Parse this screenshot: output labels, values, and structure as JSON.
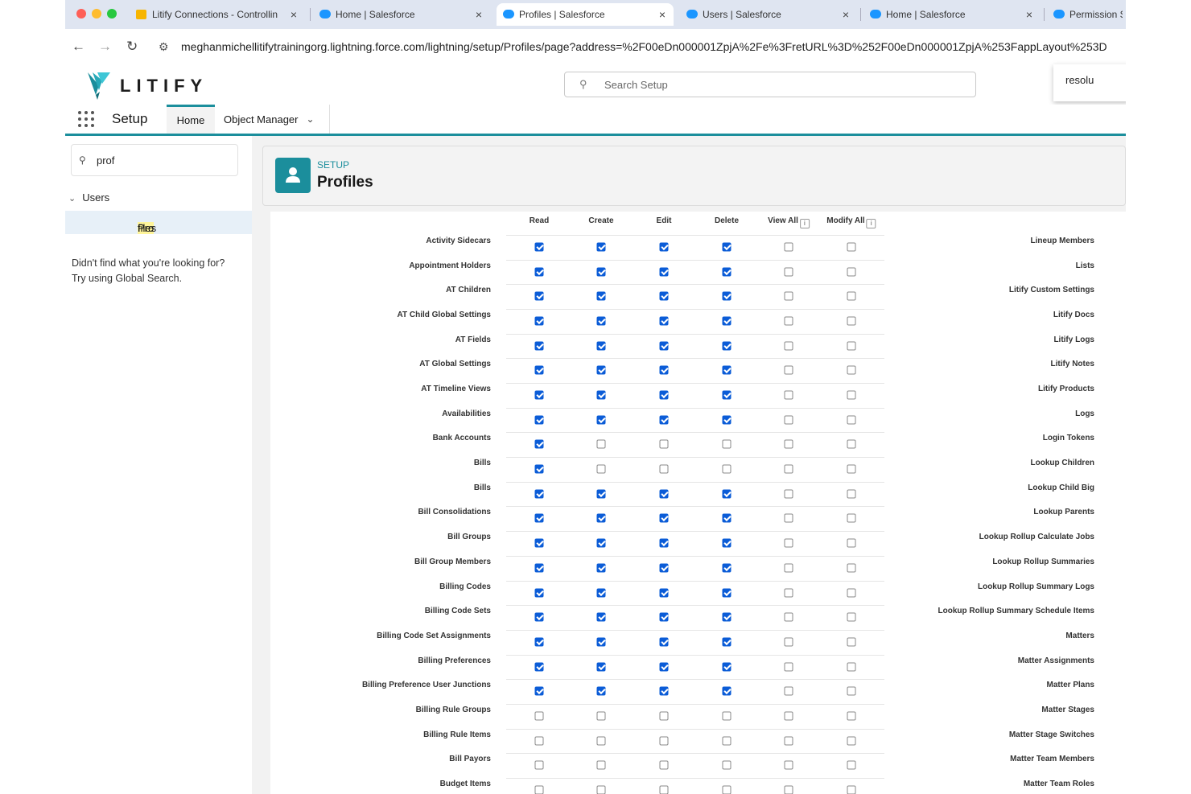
{
  "browser": {
    "tabs": [
      {
        "label": "Litify Connections - Controllin",
        "icon": "litify-favicon-icon",
        "active": false
      },
      {
        "label": "Home | Salesforce",
        "icon": "salesforce-cloud-icon",
        "active": false
      },
      {
        "label": "Profiles | Salesforce",
        "icon": "salesforce-cloud-icon",
        "active": true
      },
      {
        "label": "Users | Salesforce",
        "icon": "salesforce-cloud-icon",
        "active": false
      },
      {
        "label": "Home | Salesforce",
        "icon": "salesforce-cloud-icon",
        "active": false
      },
      {
        "label": "Permission S",
        "icon": "salesforce-cloud-icon",
        "active": false
      }
    ],
    "close_glyph": "×",
    "url": "meghanmichellitifytrainingorg.lightning.force.com/lightning/setup/Profiles/page?address=%2F00eDn000001ZpjA%2Fe%3FretURL%3D%252F00eDn000001ZpjA%253FappLayout%253D"
  },
  "header": {
    "brand": "LITIFY",
    "search_placeholder": "Search Setup",
    "popup_text": "resolu"
  },
  "nav": {
    "app_name": "Setup",
    "home_tab": "Home",
    "object_manager_tab": "Object Manager"
  },
  "sidebar": {
    "quick_find_value": "prof",
    "section": "Users",
    "item_pre": "Pro",
    "item_post": "files",
    "not_found_line1": "Didn't find what you're looking for?",
    "not_found_line2": "Try using Global Search."
  },
  "page": {
    "subtitle": "SETUP",
    "title": "Profiles"
  },
  "permissions_table": {
    "columns": [
      "Read",
      "Create",
      "Edit",
      "Delete",
      "View All",
      "Modify All"
    ],
    "columns_with_info": [
      "View All",
      "Modify All"
    ],
    "rows": [
      {
        "object": "Activity Sidecars",
        "checks": [
          1,
          1,
          1,
          1,
          0,
          0
        ]
      },
      {
        "object": "Appointment Holders",
        "checks": [
          1,
          1,
          1,
          1,
          0,
          0
        ]
      },
      {
        "object": "AT Children",
        "checks": [
          1,
          1,
          1,
          1,
          0,
          0
        ]
      },
      {
        "object": "AT Child Global Settings",
        "checks": [
          1,
          1,
          1,
          1,
          0,
          0
        ]
      },
      {
        "object": "AT Fields",
        "checks": [
          1,
          1,
          1,
          1,
          0,
          0
        ]
      },
      {
        "object": "AT Global Settings",
        "checks": [
          1,
          1,
          1,
          1,
          0,
          0
        ]
      },
      {
        "object": "AT Timeline Views",
        "checks": [
          1,
          1,
          1,
          1,
          0,
          0
        ]
      },
      {
        "object": "Availabilities",
        "checks": [
          1,
          1,
          1,
          1,
          0,
          0
        ]
      },
      {
        "object": "Bank Accounts",
        "checks": [
          1,
          0,
          0,
          0,
          0,
          0
        ]
      },
      {
        "object": "Bills",
        "checks": [
          1,
          0,
          0,
          0,
          0,
          0
        ]
      },
      {
        "object": "Bills",
        "checks": [
          1,
          1,
          1,
          1,
          0,
          0
        ]
      },
      {
        "object": "Bill Consolidations",
        "checks": [
          1,
          1,
          1,
          1,
          0,
          0
        ]
      },
      {
        "object": "Bill Groups",
        "checks": [
          1,
          1,
          1,
          1,
          0,
          0
        ]
      },
      {
        "object": "Bill Group Members",
        "checks": [
          1,
          1,
          1,
          1,
          0,
          0
        ]
      },
      {
        "object": "Billing Codes",
        "checks": [
          1,
          1,
          1,
          1,
          0,
          0
        ]
      },
      {
        "object": "Billing Code Sets",
        "checks": [
          1,
          1,
          1,
          1,
          0,
          0
        ]
      },
      {
        "object": "Billing Code Set Assignments",
        "checks": [
          1,
          1,
          1,
          1,
          0,
          0
        ]
      },
      {
        "object": "Billing Preferences",
        "checks": [
          1,
          1,
          1,
          1,
          0,
          0
        ]
      },
      {
        "object": "Billing Preference User Junctions",
        "checks": [
          1,
          1,
          1,
          1,
          0,
          0
        ]
      },
      {
        "object": "Billing Rule Groups",
        "checks": [
          0,
          0,
          0,
          0,
          0,
          0
        ]
      },
      {
        "object": "Billing Rule Items",
        "checks": [
          0,
          0,
          0,
          0,
          0,
          0
        ]
      },
      {
        "object": "Bill Payors",
        "checks": [
          0,
          0,
          0,
          0,
          0,
          0
        ]
      },
      {
        "object": "Budget Items",
        "checks": [
          0,
          0,
          0,
          0,
          0,
          0
        ]
      }
    ],
    "right_column_objects": [
      "Lineup Members",
      "Lists",
      "Litify Custom Settings",
      "Litify Docs",
      "Litify Logs",
      "Litify Notes",
      "Litify Products",
      "Logs",
      "Login Tokens",
      "Lookup Children",
      "Lookup Child Big",
      "Lookup Parents",
      "Lookup Rollup Calculate Jobs",
      "Lookup Rollup Summaries",
      "Lookup Rollup Summary Logs",
      "Lookup Rollup Summary Schedule Items",
      "Matters",
      "Matter Assignments",
      "Matter Plans",
      "Matter Stages",
      "Matter Stage Switches",
      "Matter Team Members",
      "Matter Team Roles"
    ]
  },
  "colors": {
    "accent": "#1b8e9c",
    "checkbox_checked": "#0b5cd7",
    "tabstrip": "#dfe5f1"
  }
}
